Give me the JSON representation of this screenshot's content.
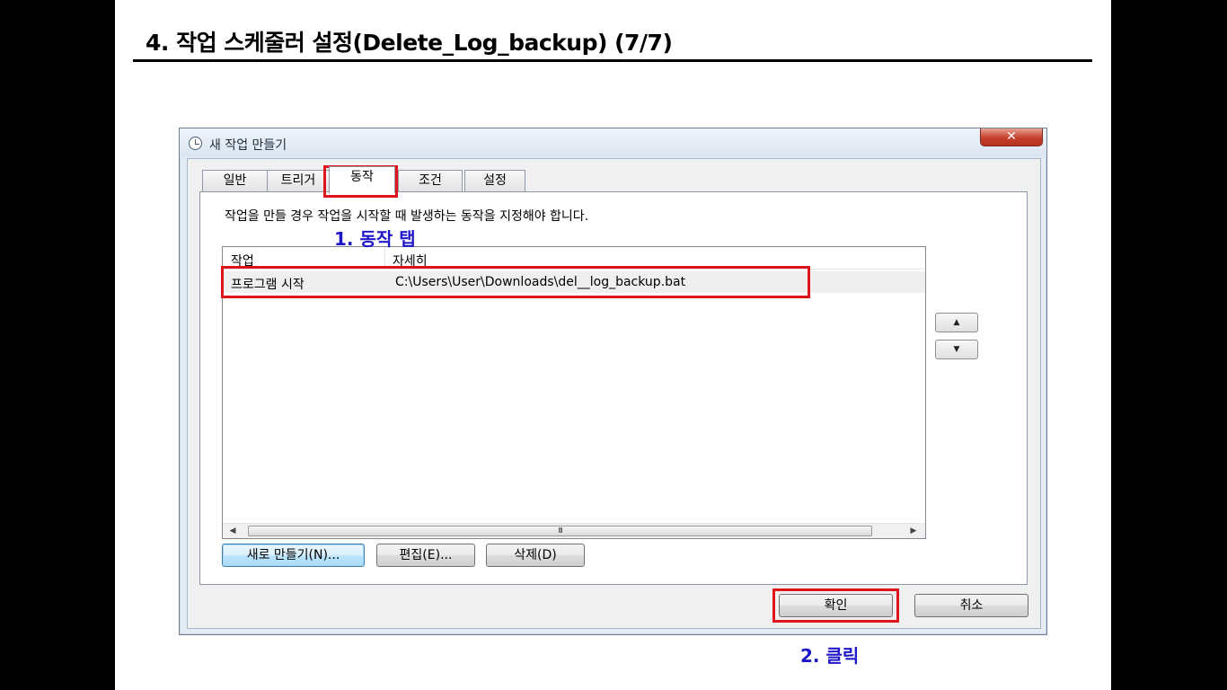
{
  "slide": {
    "title": "4. 작업 스케줄러 설정(Delete_Log_backup) (7/7)"
  },
  "dialog": {
    "title": "새 작업 만들기",
    "close_label": "✕",
    "tabs": [
      {
        "label": "일반"
      },
      {
        "label": "트리거"
      },
      {
        "label": "동작",
        "active": true
      },
      {
        "label": "조건"
      },
      {
        "label": "설정"
      }
    ],
    "description": "작업을 만들 경우 작업을 시작할 때 발생하는 동작을 지정해야 합니다.",
    "list": {
      "columns": [
        "작업",
        "자세히"
      ],
      "rows": [
        {
          "action": "프로그램 시작",
          "detail": "C:\\Users\\User\\Downloads\\del__log_backup.bat"
        }
      ],
      "scroll_left": "◀",
      "scroll_right": "▶",
      "scroll_grip": "III"
    },
    "move_up": "▲",
    "move_down": "▼",
    "buttons": {
      "new": "새로 만들기(N)...",
      "edit": "편집(E)...",
      "delete": "삭제(D)",
      "ok": "확인",
      "cancel": "취소"
    }
  },
  "annotations": {
    "step1": "1. 동작 탭",
    "step2": "2. 클릭"
  },
  "colors": {
    "highlight": "#e0141c",
    "annotation": "#1e17c8"
  }
}
